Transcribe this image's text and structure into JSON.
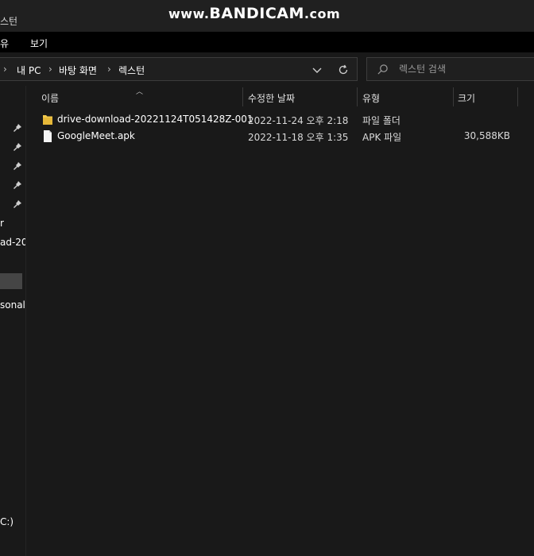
{
  "window": {
    "title": "스턴"
  },
  "watermark": {
    "www": "www.",
    "brand": "BANDICAM",
    "domain": ".com"
  },
  "menu": {
    "items": [
      "유",
      "보기"
    ]
  },
  "address": {
    "crumbs": [
      "내 PC",
      "바탕 화면",
      "렉스턴"
    ],
    "separator": "›"
  },
  "search": {
    "placeholder": "렉스턴 검색"
  },
  "nav": {
    "items": [
      "r",
      "ad-20",
      "sonal",
      "C:)"
    ]
  },
  "columns": {
    "name": "이름",
    "modified": "수정한 날짜",
    "type": "유형",
    "size": "크기"
  },
  "files": [
    {
      "name": "drive-download-20221124T051428Z-001",
      "modified": "2022-11-24 오후 2:18",
      "type": "파일 폴더",
      "size": "",
      "icon": "folder-icon"
    },
    {
      "name": "GoogleMeet.apk",
      "modified": "2022-11-18 오후 1:35",
      "type": "APK 파일",
      "size": "30,588KB",
      "icon": "file-icon"
    }
  ],
  "colors": {
    "folder": "#f2c94c",
    "background": "#191919",
    "menubar": "#000000"
  }
}
